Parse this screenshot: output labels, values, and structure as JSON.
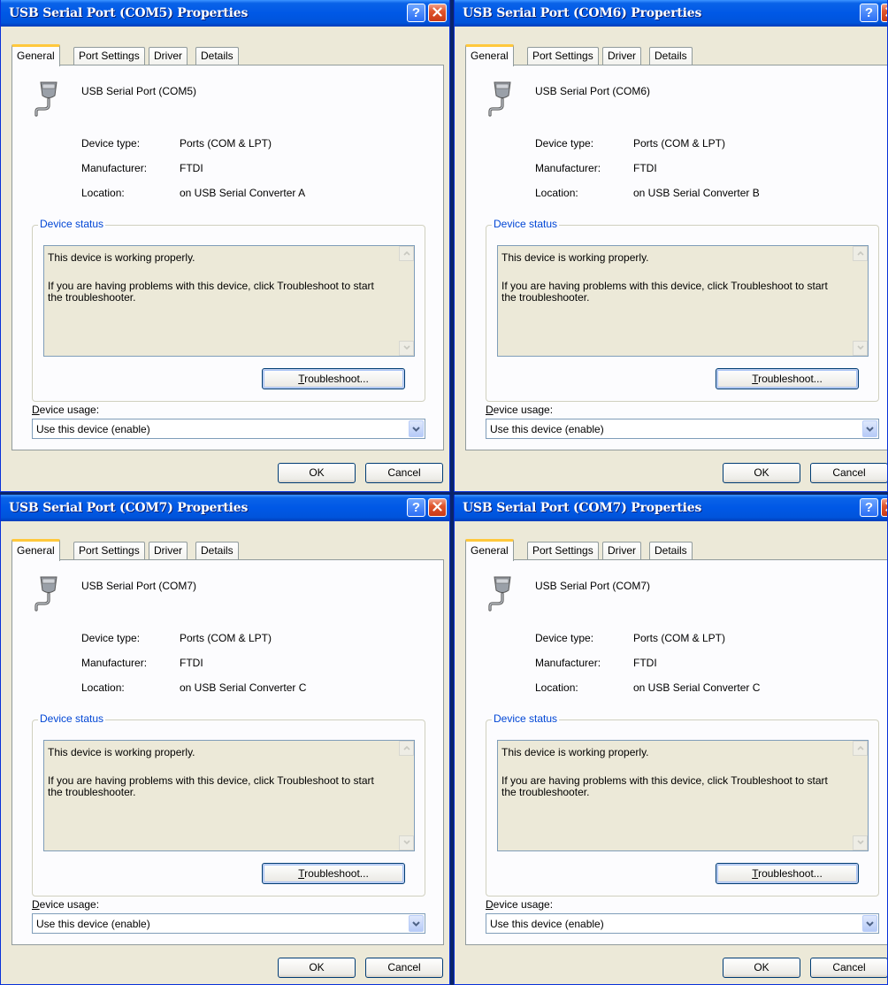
{
  "dialogs": [
    {
      "title": "USB Serial Port (COM5) Properties",
      "tabs": [
        "General",
        "Port Settings",
        "Driver",
        "Details"
      ],
      "device_name": "USB Serial Port (COM5)",
      "props": [
        {
          "label": "Device type:",
          "value": "Ports (COM & LPT)"
        },
        {
          "label": "Manufacturer:",
          "value": "FTDI"
        },
        {
          "label": "Location:",
          "value": "on USB Serial Converter A"
        }
      ],
      "status_group": "Device status",
      "status_line1": "This device is working properly.",
      "status_line2": "If you are having problems with this device, click Troubleshoot to start the troubleshooter.",
      "troubleshoot_key": "T",
      "troubleshoot_rest": "roubleshoot...",
      "usage_label_key": "D",
      "usage_label_rest": "evice usage:",
      "usage_value": "Use this device (enable)",
      "ok_label": "OK",
      "cancel_label": "Cancel"
    },
    {
      "title": "USB Serial Port (COM6) Properties",
      "tabs": [
        "General",
        "Port Settings",
        "Driver",
        "Details"
      ],
      "device_name": "USB Serial Port (COM6)",
      "props": [
        {
          "label": "Device type:",
          "value": "Ports (COM & LPT)"
        },
        {
          "label": "Manufacturer:",
          "value": "FTDI"
        },
        {
          "label": "Location:",
          "value": "on USB Serial Converter B"
        }
      ],
      "status_group": "Device status",
      "status_line1": "This device is working properly.",
      "status_line2": "If you are having problems with this device, click Troubleshoot to start the troubleshooter.",
      "troubleshoot_key": "T",
      "troubleshoot_rest": "roubleshoot...",
      "usage_label_key": "D",
      "usage_label_rest": "evice usage:",
      "usage_value": "Use this device (enable)",
      "ok_label": "OK",
      "cancel_label": "Cancel"
    },
    {
      "title": "USB Serial Port (COM7) Properties",
      "tabs": [
        "General",
        "Port Settings",
        "Driver",
        "Details"
      ],
      "device_name": "USB Serial Port (COM7)",
      "props": [
        {
          "label": "Device type:",
          "value": "Ports (COM & LPT)"
        },
        {
          "label": "Manufacturer:",
          "value": "FTDI"
        },
        {
          "label": "Location:",
          "value": "on USB Serial Converter C"
        }
      ],
      "status_group": "Device status",
      "status_line1": "This device is working properly.",
      "status_line2": "If you are having problems with this device, click Troubleshoot to start the troubleshooter.",
      "troubleshoot_key": "T",
      "troubleshoot_rest": "roubleshoot...",
      "usage_label_key": "D",
      "usage_label_rest": "evice usage:",
      "usage_value": "Use this device (enable)",
      "ok_label": "OK",
      "cancel_label": "Cancel"
    },
    {
      "title": "USB Serial Port (COM7) Properties",
      "tabs": [
        "General",
        "Port Settings",
        "Driver",
        "Details"
      ],
      "device_name": "USB Serial Port (COM7)",
      "props": [
        {
          "label": "Device type:",
          "value": "Ports (COM & LPT)"
        },
        {
          "label": "Manufacturer:",
          "value": "FTDI"
        },
        {
          "label": "Location:",
          "value": "on USB Serial Converter C"
        }
      ],
      "status_group": "Device status",
      "status_line1": "This device is working properly.",
      "status_line2": "If you are having problems with this device, click Troubleshoot to start the troubleshooter.",
      "troubleshoot_key": "T",
      "troubleshoot_rest": "roubleshoot...",
      "usage_label_key": "D",
      "usage_label_rest": "evice usage:",
      "usage_value": "Use this device (enable)",
      "ok_label": "OK",
      "cancel_label": "Cancel"
    }
  ],
  "icons": {
    "help": "help-icon",
    "close": "close-icon",
    "device": "serial-port-icon",
    "dropdown": "chevron-down-icon"
  },
  "colors": {
    "titlebar": "#0054e3",
    "dialog_face": "#ece9d8",
    "group_label": "#0046d5",
    "close_button": "#e0552d"
  }
}
